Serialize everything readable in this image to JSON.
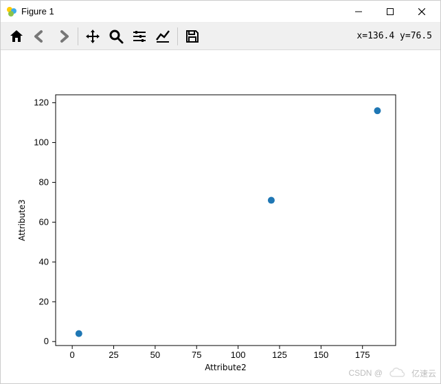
{
  "window": {
    "title": "Figure 1",
    "buttons": {
      "minimize": "–",
      "maximize": "□",
      "close": "✕"
    }
  },
  "toolbar": {
    "icons": [
      "home-icon",
      "back-icon",
      "forward-icon",
      "pan-icon",
      "zoom-icon",
      "subplots-icon",
      "axes-icon",
      "save-icon"
    ],
    "coord_readout": "x=136.4 y=76.5"
  },
  "chart_data": {
    "type": "scatter",
    "title": "",
    "xlabel": "Attribute2",
    "ylabel": "Attribute3",
    "xlim": [
      -10,
      195
    ],
    "ylim": [
      -2,
      124
    ],
    "xticks": [
      0,
      25,
      50,
      75,
      100,
      125,
      150,
      175
    ],
    "yticks": [
      0,
      20,
      40,
      60,
      80,
      100,
      120
    ],
    "x": [
      4,
      120,
      184
    ],
    "y": [
      4,
      71,
      116
    ],
    "point_color": "#1f77b4",
    "point_radius": 5
  },
  "watermark": {
    "left": "CSDN @",
    "right": "亿速云"
  }
}
